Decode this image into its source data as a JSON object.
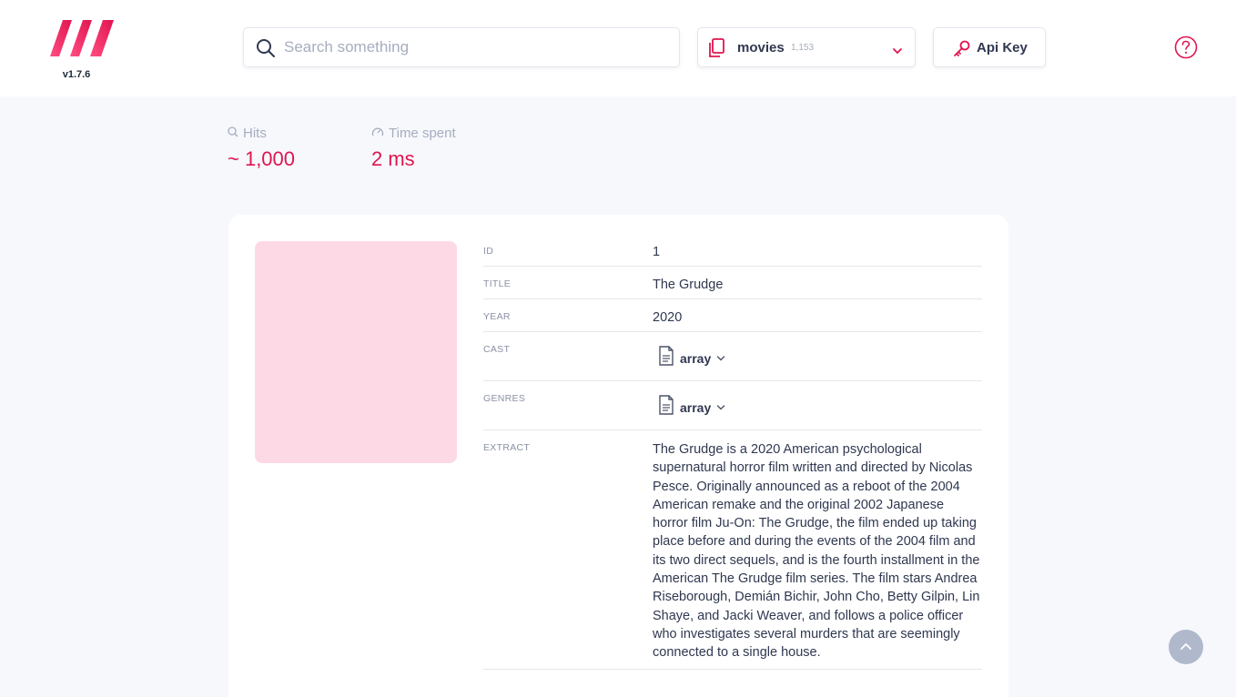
{
  "header": {
    "version": "v1.7.6",
    "search": {
      "placeholder": "Search something",
      "value": ""
    },
    "index_selector": {
      "name": "movies",
      "count": "1,153"
    },
    "api_key_label": "Api Key"
  },
  "stats": {
    "hits": {
      "label": "Hits",
      "value": "~ 1,000"
    },
    "time": {
      "label": "Time spent",
      "value": "2 ms"
    }
  },
  "document": {
    "fields": [
      {
        "key": "ID",
        "value": "1"
      },
      {
        "key": "TITLE",
        "value": "The Grudge"
      },
      {
        "key": "YEAR",
        "value": "2020"
      },
      {
        "key": "CAST",
        "value": "array"
      },
      {
        "key": "GENRES",
        "value": "array"
      },
      {
        "key": "EXTRACT",
        "value": "The Grudge is a 2020 American psychological supernatural horror film written and directed by Nicolas Pesce. Originally announced as a reboot of the 2004 American remake and the original 2002 Japanese horror film Ju-On: The Grudge, the film ended up taking place before and during the events of the 2004 film and its two direct sequels, and is the fourth installment in the American The Grudge film series. The film stars Andrea Riseborough, Demián Bichir, John Cho, Betty Gilpin, Lin Shaye, and Jacki Weaver, and follows a police officer who investigates several murders that are seemingly connected to a single house."
      }
    ]
  },
  "colors": {
    "accent": "#e0154f",
    "muted": "#a6adbf",
    "poster_placeholder": "#fdd9e5",
    "background": "#f6f8fc"
  },
  "icons": {
    "logo": "meilisearch-logo",
    "search": "search-icon",
    "index": "document-icon",
    "key": "key-icon",
    "help": "question-circle-icon",
    "hits": "search-icon",
    "time": "speedometer-icon",
    "scroll": "arrow-up-icon"
  }
}
